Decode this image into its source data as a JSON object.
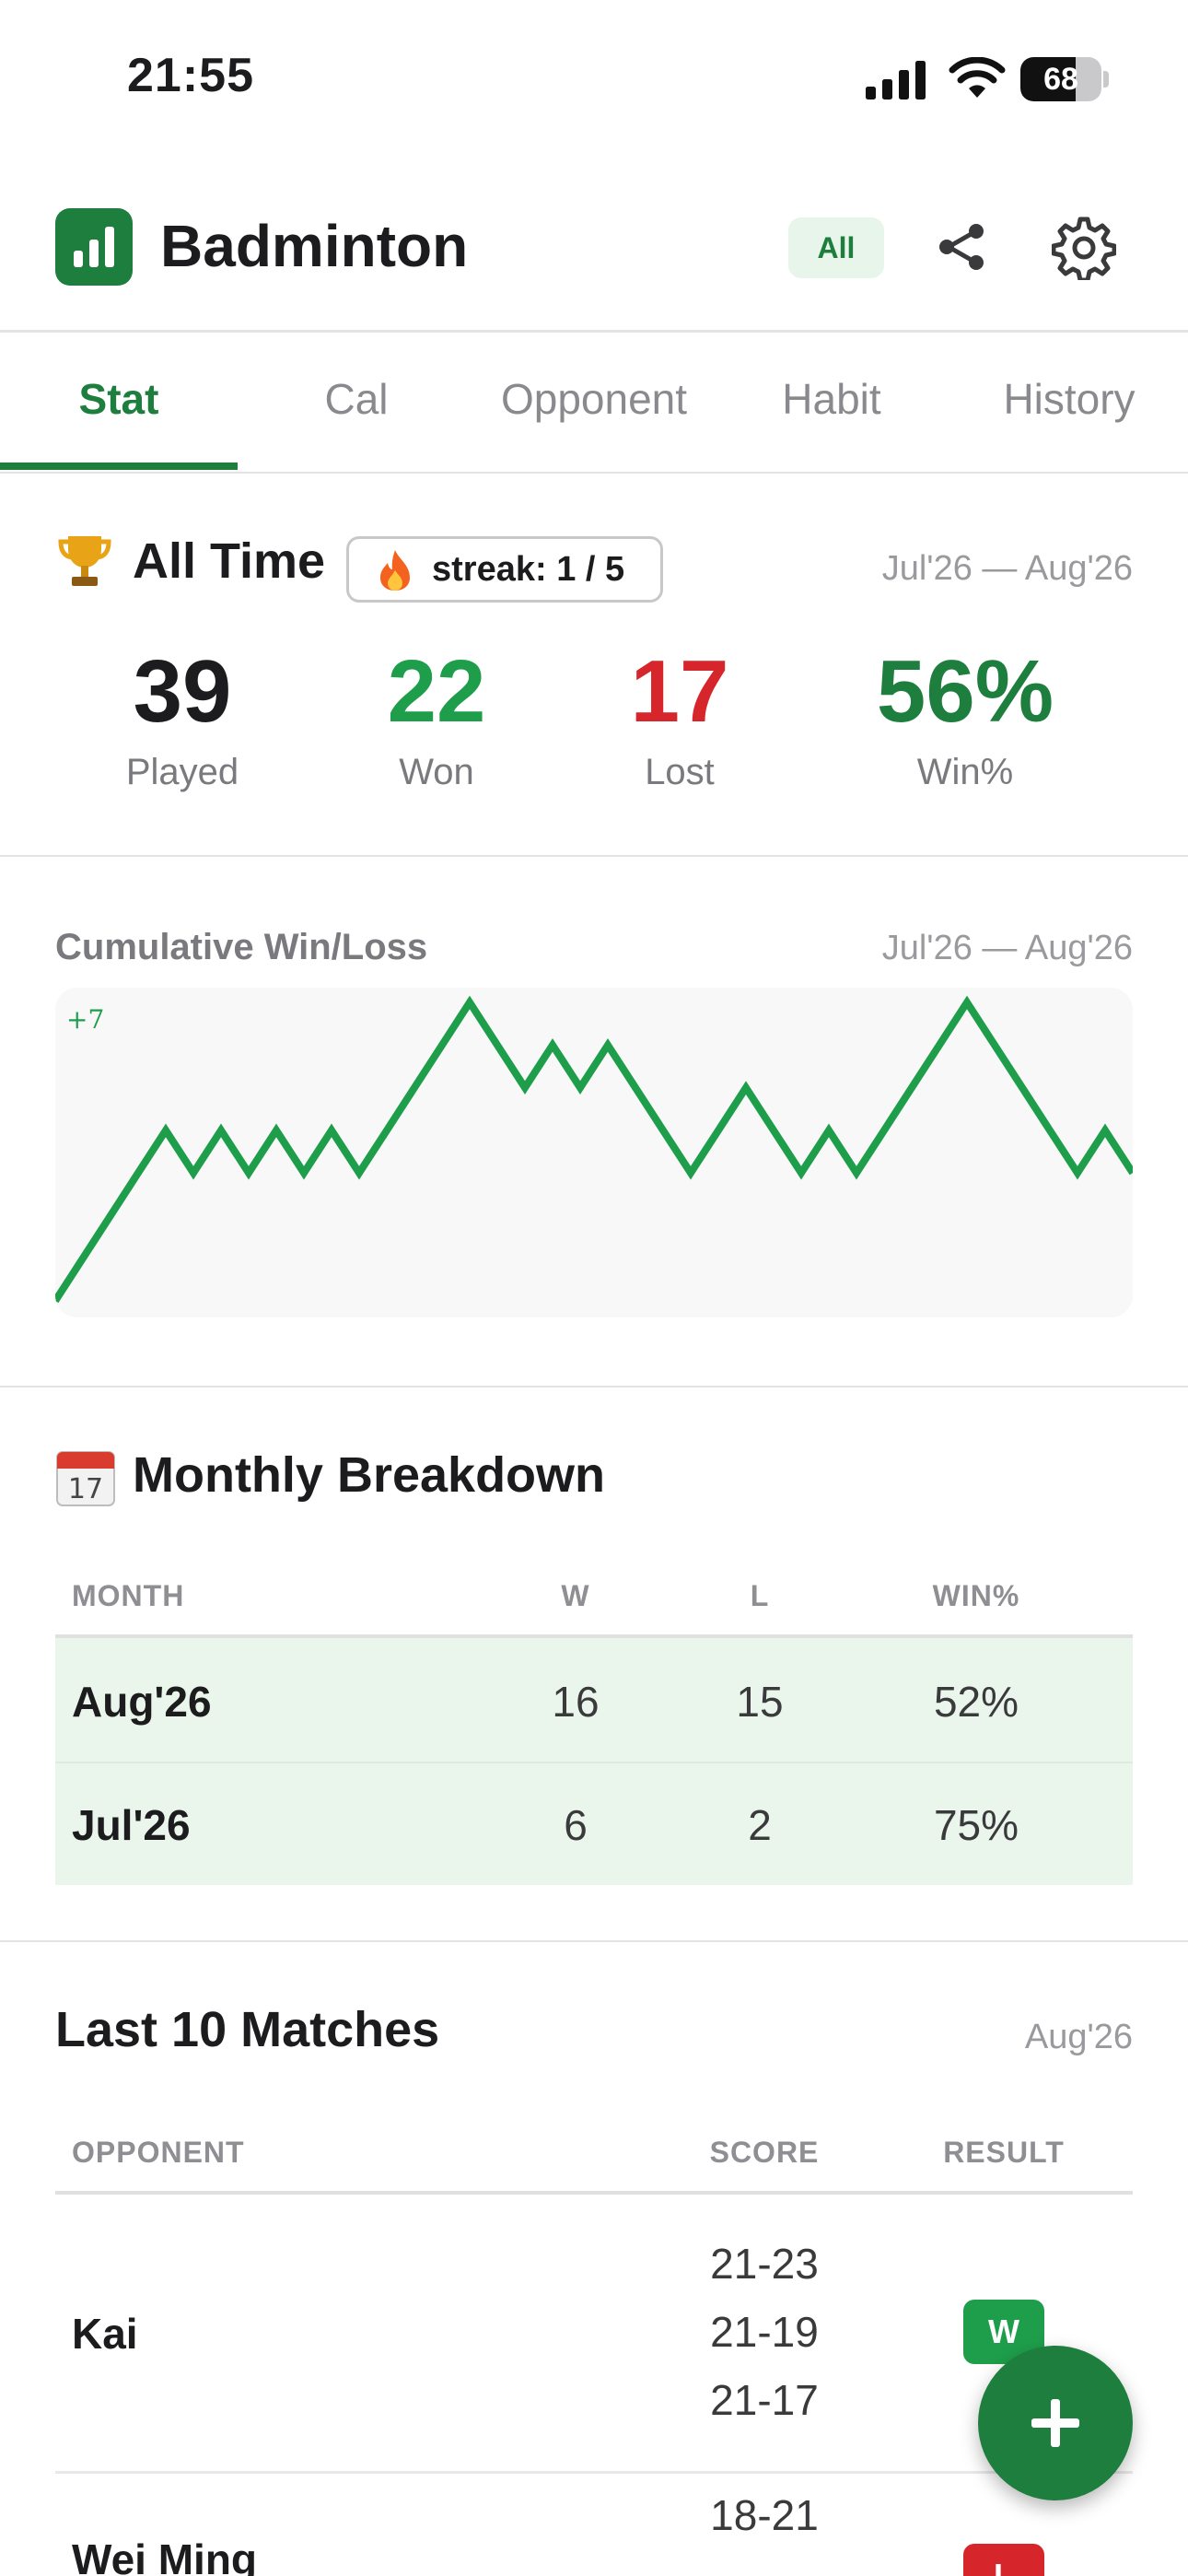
{
  "status_bar": {
    "time": "21:55",
    "battery": "68",
    "battery_level": 0.68
  },
  "header": {
    "title": "Badminton",
    "filter_label": "All",
    "icons": [
      "bar-chart-icon",
      "share-icon",
      "gear-icon"
    ]
  },
  "tabs": [
    "Stat",
    "Cal",
    "Opponent",
    "Habit",
    "History"
  ],
  "active_tab": "Stat",
  "all_time": {
    "title": "All Time",
    "streak": "streak: 1 / 5",
    "date_range": "Jul'26 — Aug'26",
    "stats": [
      {
        "value": "39",
        "label": "Played",
        "color": "#1c1c1e"
      },
      {
        "value": "22",
        "label": "Won",
        "color": "#1e9e4a"
      },
      {
        "value": "17",
        "label": "Lost",
        "color": "#d6262b"
      },
      {
        "value": "56%",
        "label": "Win%",
        "color": "#1e7e3e"
      }
    ]
  },
  "cumulative": {
    "title": "Cumulative Win/Loss",
    "date_range": "Jul'26 — Aug'26",
    "max_label": "+7",
    "chart_data": {
      "type": "line",
      "x": [
        0,
        1,
        2,
        3,
        4,
        5,
        6,
        7,
        8,
        9,
        10,
        11,
        12,
        13,
        14,
        15,
        16,
        17,
        18,
        19,
        20,
        21,
        22,
        23,
        24,
        25,
        26,
        27,
        28,
        29,
        30,
        31,
        32,
        33,
        34,
        35,
        36,
        37,
        38,
        39
      ],
      "y": [
        0,
        1,
        2,
        3,
        4,
        3,
        4,
        3,
        4,
        3,
        4,
        3,
        4,
        5,
        6,
        7,
        6,
        5,
        6,
        5,
        6,
        5,
        4,
        3,
        4,
        5,
        4,
        3,
        4,
        3,
        4,
        5,
        6,
        7,
        6,
        5,
        4,
        3,
        4,
        3
      ],
      "ylim": [
        0,
        7
      ],
      "color": "#1e9e4a"
    }
  },
  "monthly": {
    "title": "Monthly Breakdown",
    "columns": [
      "MONTH",
      "W",
      "L",
      "WIN%"
    ],
    "rows": [
      {
        "month": "Aug'26",
        "w": "16",
        "l": "15",
        "pct": "52%"
      },
      {
        "month": "Jul'26",
        "w": "6",
        "l": "2",
        "pct": "75%"
      }
    ]
  },
  "last_matches": {
    "title": "Last 10 Matches",
    "date_range": "Aug'26",
    "columns": [
      "OPPONENT",
      "SCORE",
      "RESULT"
    ],
    "rows": [
      {
        "opponent": "Kai",
        "scores": [
          "21-23",
          "21-19",
          "21-17"
        ],
        "result": "W",
        "result_color": "#1e9e4a"
      },
      {
        "opponent": "Wei Ming",
        "scores": [
          "18-21"
        ],
        "result": "L",
        "result_color": "#d6262b"
      }
    ]
  },
  "fab_icon": "plus-icon"
}
